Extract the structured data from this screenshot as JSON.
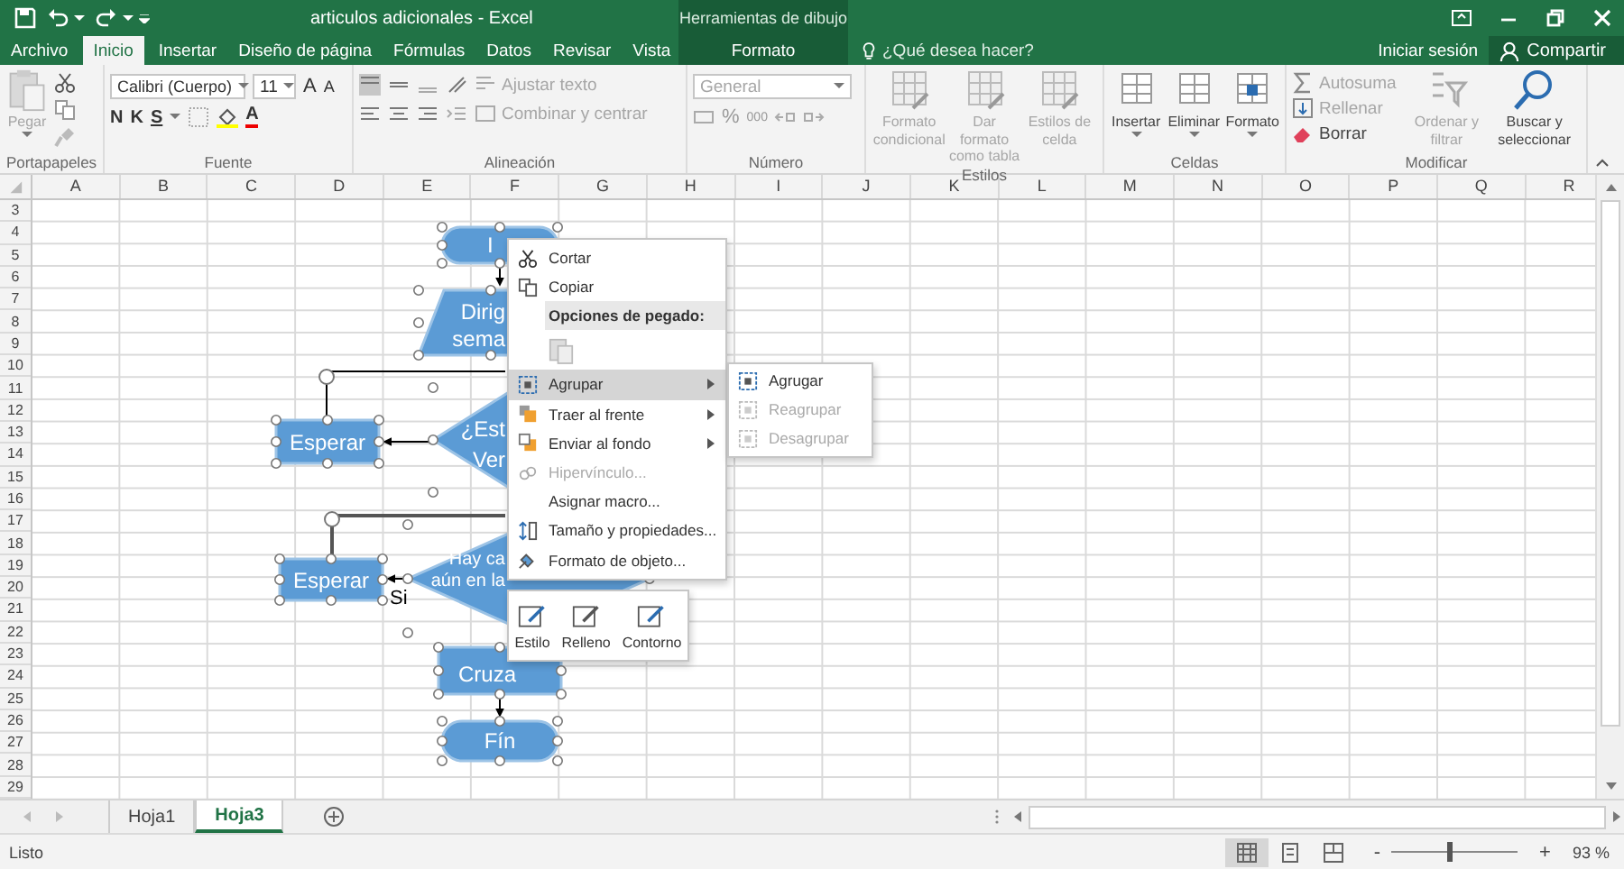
{
  "title_bar": {
    "title": "articulos adicionales - Excel",
    "tool_group": "Herramientas de dibujo"
  },
  "tabs": [
    {
      "label": "Archivo",
      "selected": false
    },
    {
      "label": "Inicio",
      "selected": true
    },
    {
      "label": "Insertar",
      "selected": false
    },
    {
      "label": "Diseño de página",
      "selected": false
    },
    {
      "label": "Fórmulas",
      "selected": false
    },
    {
      "label": "Datos",
      "selected": false
    },
    {
      "label": "Revisar",
      "selected": false
    },
    {
      "label": "Vista",
      "selected": false
    }
  ],
  "context_tab": {
    "label": "Formato",
    "selected": false
  },
  "tell_me": {
    "label": "¿Qué desea hacer?"
  },
  "account": {
    "sign_in": "Iniciar sesión",
    "share": "Compartir"
  },
  "ribbon": {
    "clipboard": {
      "label": "Portapapeles",
      "paste": {
        "label": "Pegar",
        "disabled": true
      }
    },
    "font": {
      "label": "Fuente",
      "font_name": "Calibri (Cuerpo)",
      "font_size": "11",
      "grow": "A",
      "shrink": "A",
      "bold": "N",
      "italic": "K",
      "underline": "S",
      "font_color": "A"
    },
    "alignment": {
      "label": "Alineación",
      "wrap_text": {
        "label": "Ajustar texto",
        "disabled": true
      },
      "merge": {
        "label": "Combinar y centrar",
        "disabled": true
      }
    },
    "number": {
      "label": "Número",
      "format": {
        "value": "General",
        "disabled": true
      },
      "percent": "%",
      "thousands": "000"
    },
    "styles": {
      "label": "Estilos",
      "buttons": [
        {
          "label": "Formato condicional",
          "disabled": true
        },
        {
          "label": "Dar formato como tabla",
          "disabled": true
        },
        {
          "label": "Estilos de celda",
          "disabled": true
        }
      ]
    },
    "cells": {
      "label": "Celdas",
      "buttons": [
        {
          "label": "Insertar",
          "disabled": false
        },
        {
          "label": "Eliminar",
          "disabled": false
        },
        {
          "label": "Formato",
          "disabled": false
        }
      ]
    },
    "editing": {
      "label": "Modificar",
      "autosum": {
        "label": "Autosuma",
        "disabled": true
      },
      "fill": {
        "label": "Rellenar",
        "disabled": true
      },
      "clear": {
        "label": "Borrar",
        "disabled": false
      },
      "sort": {
        "label": "Ordenar y filtrar",
        "disabled": true
      },
      "find": {
        "label": "Buscar y seleccionar",
        "disabled": false
      }
    }
  },
  "sheet": {
    "columns": [
      "A",
      "B",
      "C",
      "D",
      "E",
      "F",
      "G",
      "H",
      "I",
      "J",
      "K",
      "L",
      "M",
      "N",
      "O",
      "P",
      "Q",
      "R"
    ],
    "rows": [
      "3",
      "4",
      "5",
      "6",
      "7",
      "8",
      "9",
      "10",
      "11",
      "12",
      "13",
      "14",
      "15",
      "16",
      "17",
      "18",
      "19",
      "20",
      "21",
      "22",
      "23",
      "24",
      "25",
      "26",
      "27",
      "28",
      "29"
    ]
  },
  "flowchart": {
    "shapes": [
      {
        "kind": "terminal",
        "lines": [
          "I"
        ]
      },
      {
        "kind": "data",
        "lines": [
          "Dirig",
          "sema"
        ]
      },
      {
        "kind": "process",
        "lines": [
          "Esperar"
        ]
      },
      {
        "kind": "decision",
        "lines": [
          "¿Est",
          "Ver"
        ]
      },
      {
        "kind": "process",
        "lines": [
          "Esperar"
        ]
      },
      {
        "kind": "decision",
        "lines": [
          "Hay ca",
          "aún en la"
        ]
      },
      {
        "kind": "process",
        "lines": [
          "Cruza"
        ]
      },
      {
        "kind": "terminal",
        "lines": [
          "Fín"
        ]
      }
    ],
    "labels": [
      "Si"
    ]
  },
  "context_menu": {
    "items": [
      {
        "kind": "item",
        "label": "Cortar",
        "disabled": false,
        "selected": false
      },
      {
        "kind": "item",
        "label": "Copiar",
        "disabled": false,
        "selected": false
      },
      {
        "kind": "header",
        "label": "Opciones de pegado:"
      },
      {
        "kind": "paste"
      },
      {
        "kind": "submenu",
        "label": "Agrupar",
        "disabled": false,
        "selected": true
      },
      {
        "kind": "submenu",
        "label": "Traer al frente",
        "disabled": false,
        "selected": false
      },
      {
        "kind": "submenu",
        "label": "Enviar al fondo",
        "disabled": false,
        "selected": false
      },
      {
        "kind": "item",
        "label": "Hipervínculo...",
        "disabled": true,
        "selected": false
      },
      {
        "kind": "item",
        "label": "Asignar macro...",
        "disabled": false,
        "selected": false
      },
      {
        "kind": "item",
        "label": "Tamaño y propiedades...",
        "disabled": false,
        "selected": false
      },
      {
        "kind": "item",
        "label": "Formato de objeto...",
        "disabled": false,
        "selected": false
      }
    ]
  },
  "submenu": {
    "items": [
      {
        "label": "Agrugar",
        "disabled": false
      },
      {
        "label": "Reagrupar",
        "disabled": true
      },
      {
        "label": "Desagrupar",
        "disabled": true
      }
    ]
  },
  "mini_toolbar": {
    "buttons": [
      "Estilo",
      "Relleno",
      "Contorno"
    ]
  },
  "sheet_tabs": [
    {
      "label": "Hoja1",
      "selected": false
    },
    {
      "label": "Hoja3",
      "selected": true
    }
  ],
  "status_bar": {
    "status": "Listo",
    "zoom": {
      "minus": "-",
      "plus": "+",
      "level": 0.46,
      "reading": "93 %"
    }
  }
}
